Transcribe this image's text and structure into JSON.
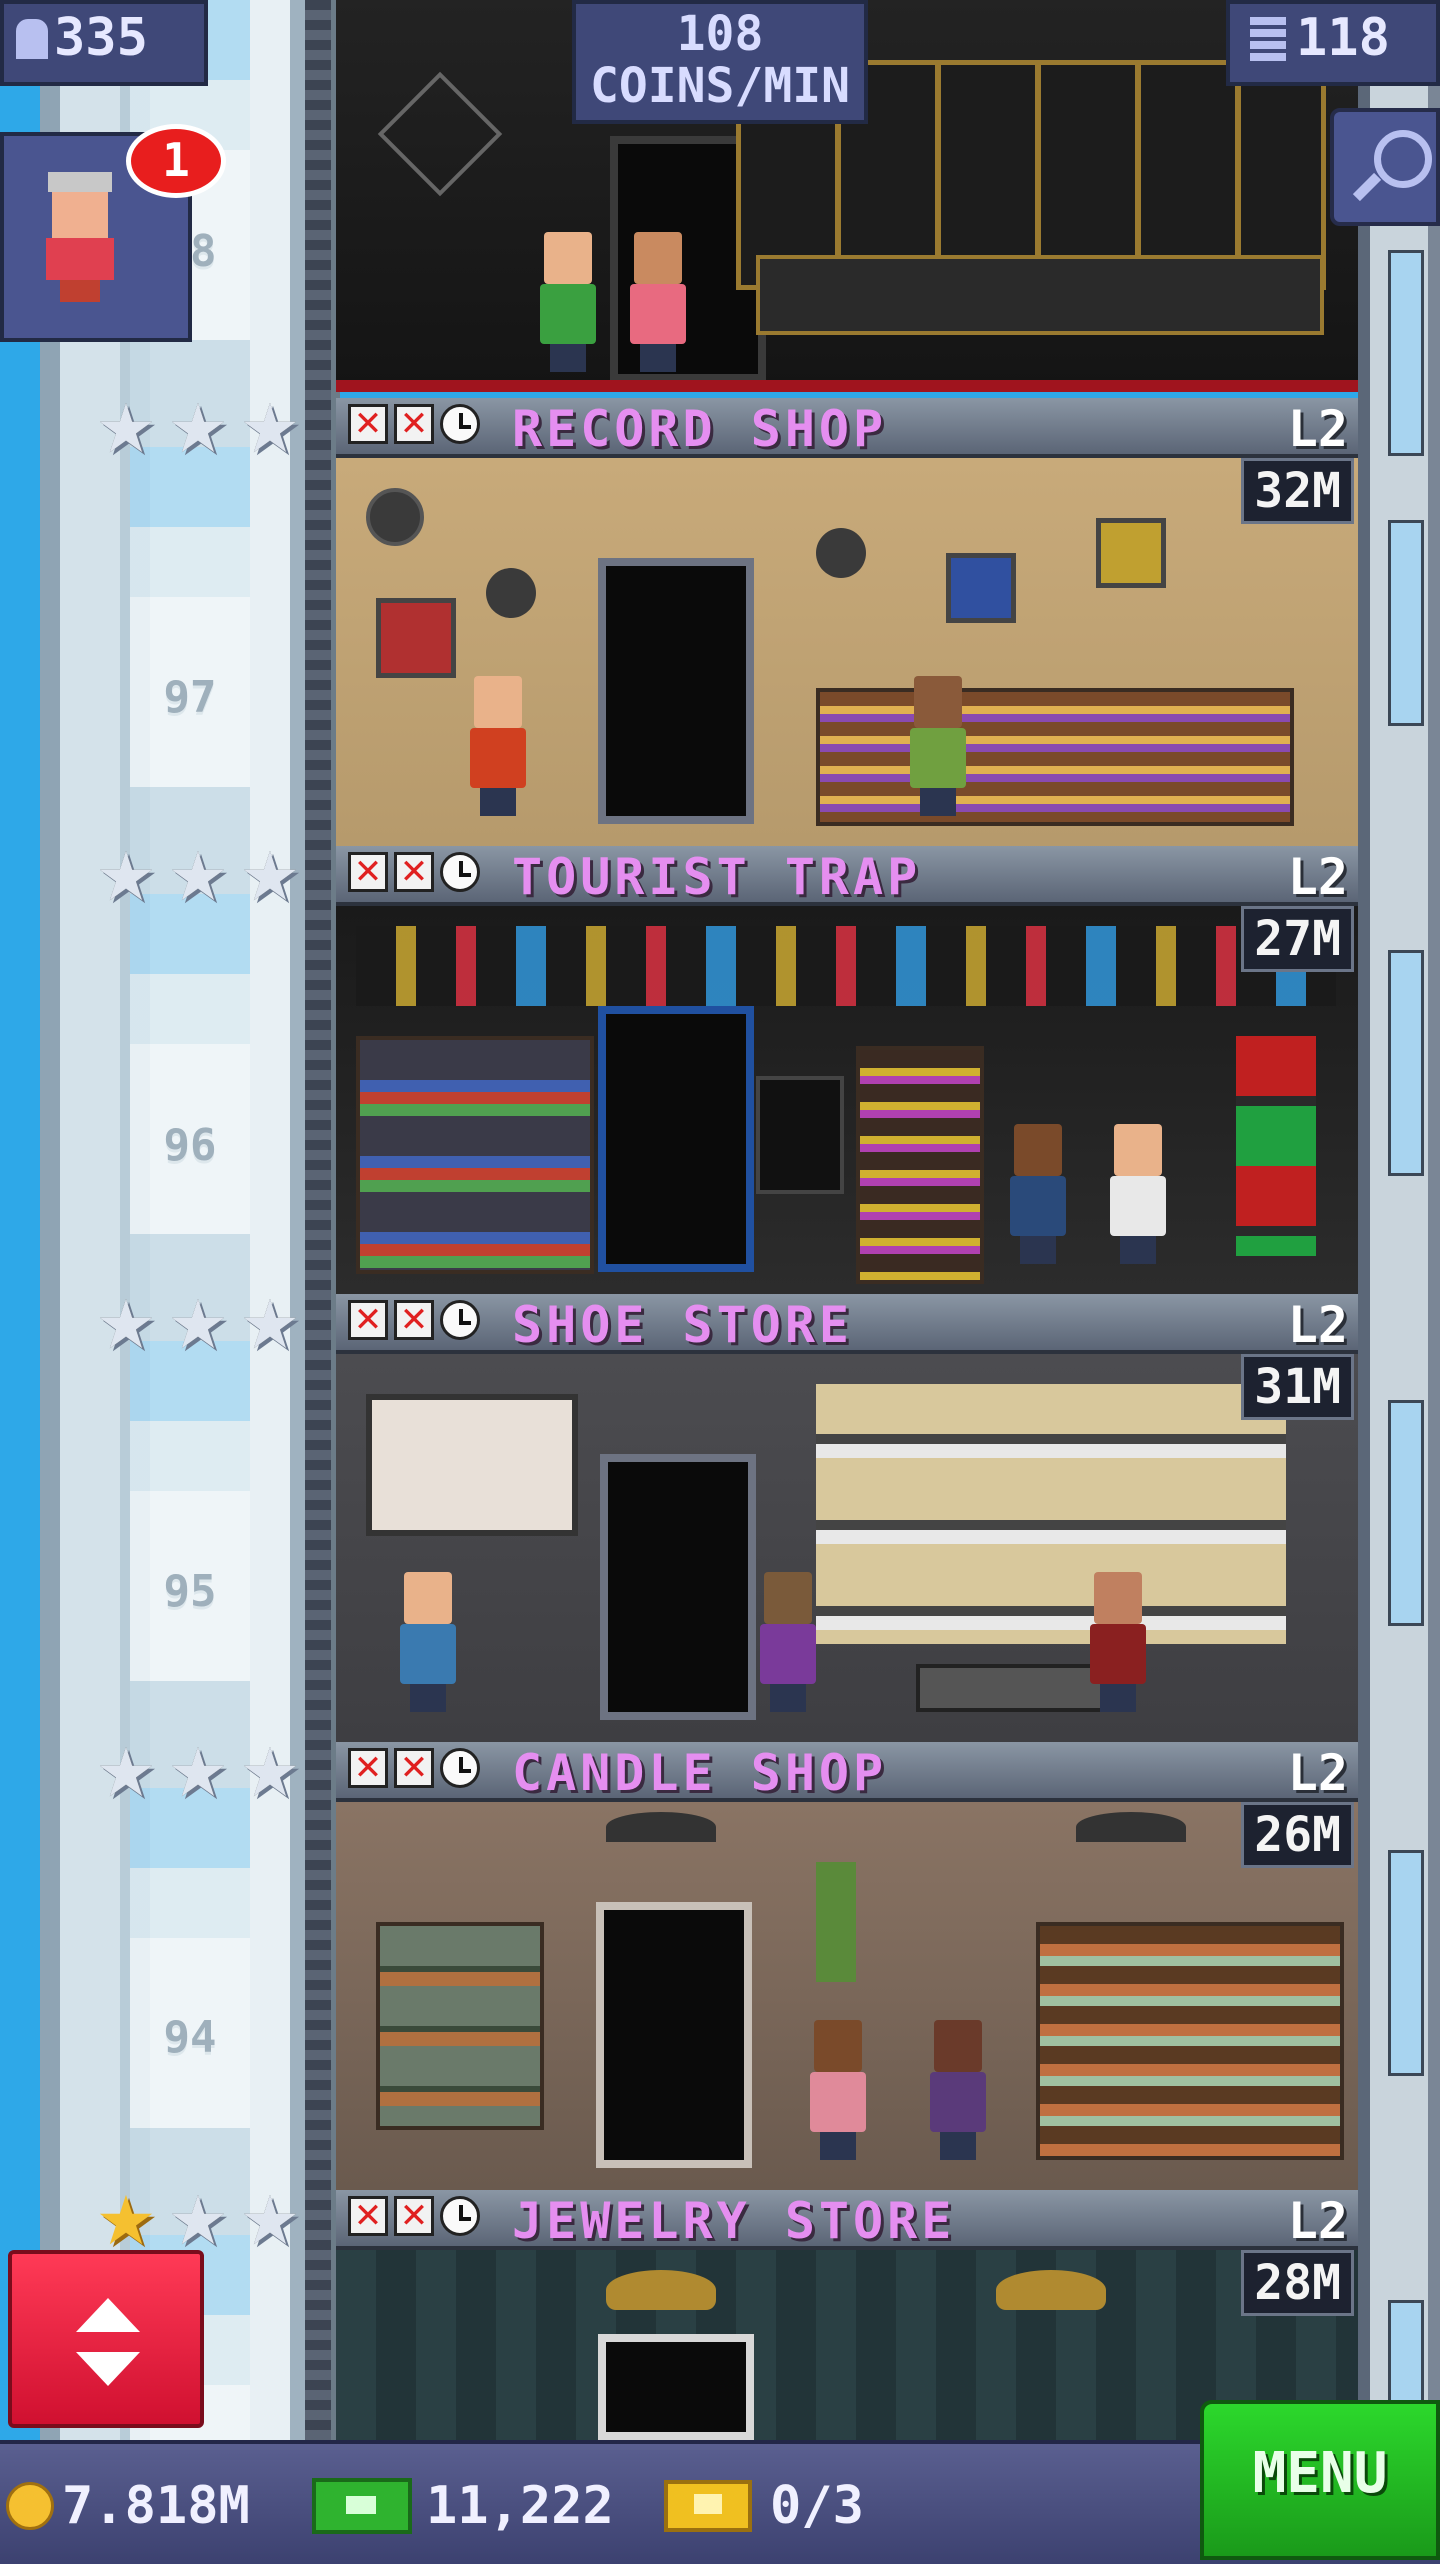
{
  "hud": {
    "population": "335",
    "coins_rate_value": "108",
    "coins_rate_unit": "COINS/MIN",
    "floor_count": "118"
  },
  "visitor": {
    "notification_count": "1"
  },
  "floor_numbers": [
    "98",
    "97",
    "96",
    "95",
    "94"
  ],
  "floors": [
    {
      "name": "RECORD SHOP",
      "level": "L2",
      "coins": "32M",
      "stars_gold": 0
    },
    {
      "name": "TOURIST TRAP",
      "level": "L2",
      "coins": "27M",
      "stars_gold": 0
    },
    {
      "name": "SHOE STORE",
      "level": "L2",
      "coins": "31M",
      "stars_gold": 0
    },
    {
      "name": "CANDLE SHOP",
      "level": "L2",
      "coins": "26M",
      "stars_gold": 0
    },
    {
      "name": "JEWELRY STORE",
      "level": "L2",
      "coins": "28M",
      "stars_gold": 1
    }
  ],
  "bottom_bar": {
    "coins": "7.818M",
    "bux": "11,222",
    "tickets": "0/3",
    "menu_label": "MENU"
  },
  "icons": {
    "population": "person-icon",
    "floors": "building-icon",
    "search": "magnifier-icon",
    "elevator": "up-down-arrows-icon",
    "coin": "coin-icon",
    "bux": "bux-bill-icon",
    "ticket": "ticket-icon",
    "star": "star-icon",
    "cross": "x-icon",
    "clock": "clock-icon"
  },
  "colors": {
    "floor_name": "#e58ef0",
    "menu_green": "#2cd82c",
    "elevator_red": "#ff3a56",
    "hud_purple": "#3f4878"
  }
}
